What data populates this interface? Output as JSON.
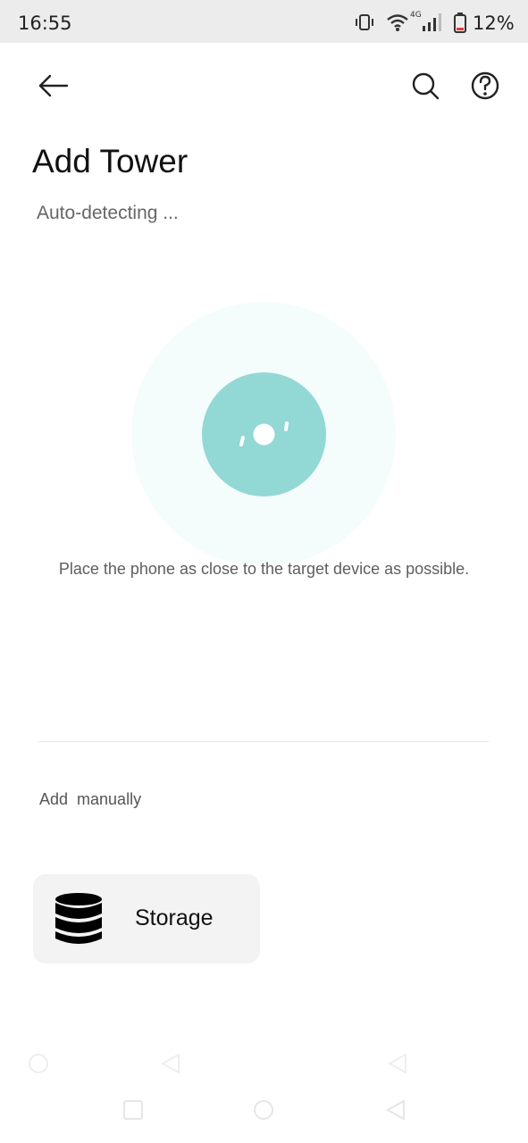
{
  "status_bar": {
    "time": "16:55",
    "network_label": "4G",
    "battery_percent": "12%",
    "icons": [
      "vibrate-icon",
      "wifi-icon",
      "signal-icon",
      "battery-icon"
    ]
  },
  "toolbar": {
    "back_icon": "arrow-left-icon",
    "search_icon": "search-icon",
    "help_icon": "help-icon"
  },
  "header": {
    "title": "Add Tower",
    "subtitle": "Auto-detecting ..."
  },
  "detection": {
    "hint": "Place the phone as close to the target device as possible.",
    "outer_color": "#f5fcfc",
    "inner_color": "#92d8d4"
  },
  "manual": {
    "section_label": "Add  manually",
    "items": [
      {
        "label": "Storage",
        "icon": "database-icon"
      }
    ]
  },
  "colors": {
    "accent": "#92d8d4",
    "card_bg": "#f3f3f3",
    "status_bar_bg": "#ececec"
  }
}
